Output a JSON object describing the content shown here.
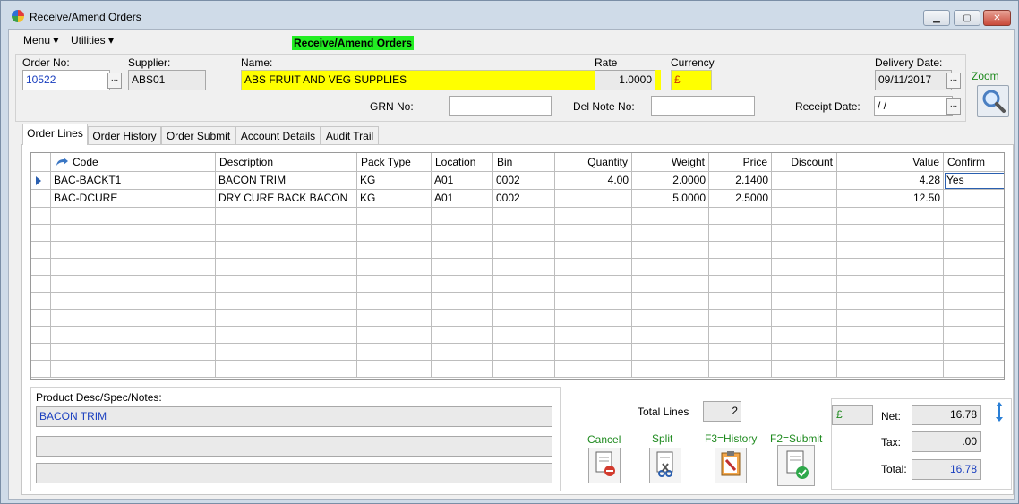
{
  "window": {
    "title": "Receive/Amend Orders",
    "min": "▁",
    "max": "▢",
    "close": "✕"
  },
  "menubar": {
    "menu": "Menu ▾",
    "utilities": "Utilities ▾",
    "banner": "Receive/Amend Orders"
  },
  "header": {
    "order_no_label": "Order No:",
    "order_no": "10522",
    "supplier_label": "Supplier:",
    "supplier": "ABS01",
    "name_label": "Name:",
    "name": "ABS  FRUIT AND VEG SUPPLIES",
    "rate_label": "Rate",
    "rate": "1.0000",
    "currency_label": "Currency",
    "currency": "£",
    "delivery_label": "Delivery Date:",
    "delivery": "09/11/2017",
    "grn_label": "GRN No:",
    "grn": "",
    "delnote_label": "Del Note No:",
    "delnote": "",
    "receipt_label": "Receipt Date:",
    "receipt": " /  /",
    "zoom_label": "Zoom",
    "ellipsis": "..."
  },
  "tabs": [
    "Order Lines",
    "Order History",
    "Order Submit",
    "Account Details",
    "Audit Trail"
  ],
  "grid": {
    "columns": [
      "Code",
      "Description",
      "Pack Type",
      "Location",
      "Bin",
      "Quantity",
      "Weight",
      "Price",
      "Discount",
      "Value",
      "Confirm"
    ],
    "rows": [
      [
        "BAC-BACKT1",
        "BACON TRIM",
        "KG",
        "A01",
        "0002",
        "4.00",
        "2.0000",
        "2.1400",
        "",
        "4.28",
        "Yes"
      ],
      [
        "BAC-DCURE",
        "DRY CURE BACK BACON",
        "KG",
        "A01",
        "0002",
        "",
        "5.0000",
        "2.5000",
        "",
        "12.50",
        ""
      ]
    ]
  },
  "notes": {
    "label": "Product Desc/Spec/Notes:",
    "line1": "BACON TRIM",
    "line2": "",
    "line3": ""
  },
  "actions": {
    "total_lines_label": "Total Lines",
    "total_lines": "2",
    "cancel": "Cancel",
    "split": "Split",
    "history": "F3=History",
    "submit": "F2=Submit"
  },
  "totals": {
    "currency": "£",
    "net_label": "Net:",
    "net": "16.78",
    "tax_label": "Tax:",
    "tax": ".00",
    "total_label": "Total:",
    "total": "16.78"
  }
}
